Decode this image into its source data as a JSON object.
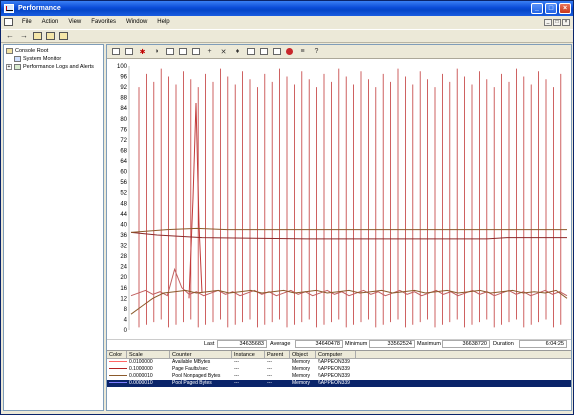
{
  "window": {
    "title": "Performance"
  },
  "menu": [
    "File",
    "Action",
    "View",
    "Favorites",
    "Window",
    "Help"
  ],
  "tree": [
    {
      "label": "Console Root",
      "level": 0
    },
    {
      "label": "System Monitor",
      "level": 1
    },
    {
      "label": "Performance Logs and Alerts",
      "level": 1
    }
  ],
  "y_ticks": [
    "100",
    "96",
    "92",
    "88",
    "84",
    "80",
    "76",
    "72",
    "68",
    "64",
    "60",
    "56",
    "52",
    "48",
    "44",
    "40",
    "36",
    "32",
    "28",
    "24",
    "20",
    "16",
    "12",
    "8",
    "4",
    "0"
  ],
  "value_bar": {
    "last_label": "Last",
    "last_value": "34635683",
    "average_label": "Average",
    "average_value": "34640478",
    "minimum_label": "Minimum",
    "minimum_value": "33562524",
    "maximum_label": "Maximum",
    "maximum_value": "36638720",
    "duration_label": "Duration",
    "duration_value": "6:04:25"
  },
  "legend": {
    "headers": [
      "Color",
      "Scale",
      "Counter",
      "Instance",
      "Parent",
      "Object",
      "Computer"
    ],
    "rows": [
      {
        "color": "#ff6666",
        "scale": "0.0100000",
        "counter": "Available MBytes",
        "instance": "---",
        "parent": "---",
        "object": "Memory",
        "computer": "\\\\APPEON339",
        "selected": false
      },
      {
        "color": "#b22222",
        "scale": "0.1000000",
        "counter": "Page Faults/sec",
        "instance": "---",
        "parent": "---",
        "object": "Memory",
        "computer": "\\\\APPEON339",
        "selected": false
      },
      {
        "color": "#8b5a2b",
        "scale": "0.0000010",
        "counter": "Pool Nonpaged Bytes",
        "instance": "---",
        "parent": "---",
        "object": "Memory",
        "computer": "\\\\APPEON339",
        "selected": false
      },
      {
        "color": "#2f2fb0",
        "scale": "0.0000010",
        "counter": "Pool Paged Bytes",
        "instance": "---",
        "parent": "---",
        "object": "Memory",
        "computer": "\\\\APPEON339",
        "selected": true
      }
    ]
  },
  "colors": {
    "spike": "#c23a3a",
    "line_a": "#8b2a2a",
    "line_b": "#8b5a2b",
    "line_c": "#c06060"
  }
}
